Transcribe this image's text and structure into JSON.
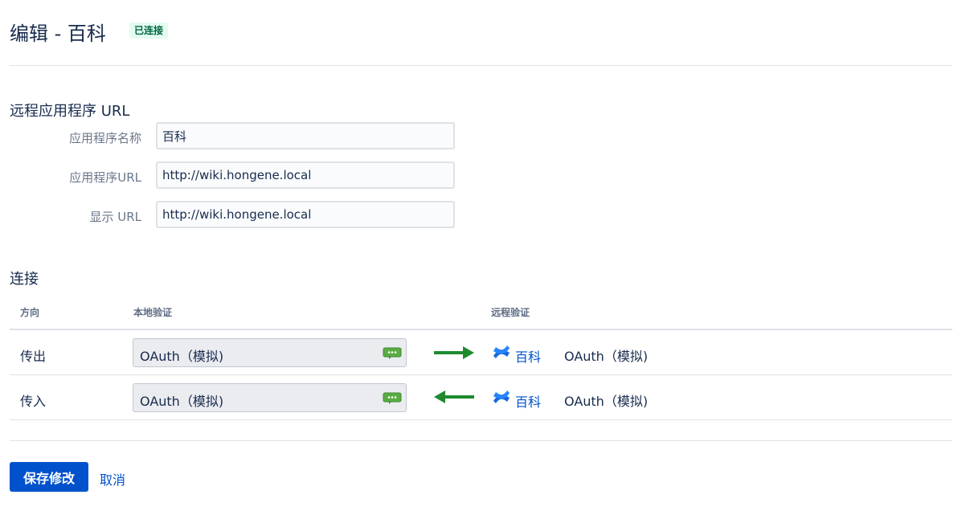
{
  "header": {
    "title": "编辑 - 百科",
    "status_badge": "已连接"
  },
  "remote_app": {
    "section_title": "远程应用程序 URL",
    "fields": [
      {
        "label": "应用程序名称",
        "value": "百科"
      },
      {
        "label": "应用程序URL",
        "value": "http://wiki.hongene.local"
      },
      {
        "label": "显示 URL",
        "value": "http://wiki.hongene.local"
      }
    ]
  },
  "connection": {
    "section_title": "连接",
    "columns": {
      "direction": "方向",
      "local_auth": "本地验证",
      "remote_auth": "远程验证"
    },
    "rows": [
      {
        "direction": "传出",
        "local_auth": "OAuth（模拟)",
        "arrow": "right",
        "remote_name": "百科",
        "remote_auth": "OAuth（模拟)"
      },
      {
        "direction": "传入",
        "local_auth": "OAuth（模拟)",
        "arrow": "left",
        "remote_name": "百科",
        "remote_auth": "OAuth（模拟)"
      }
    ],
    "icons": {
      "local_auth": "edit-comment-icon",
      "remote_app": "confluence-logo-icon"
    },
    "colors": {
      "arrow": "#1e8a2e",
      "remote_logo": "#1868db",
      "link": "#0052cc"
    }
  },
  "actions": {
    "save_label": "保存修改",
    "cancel_label": "取消"
  }
}
